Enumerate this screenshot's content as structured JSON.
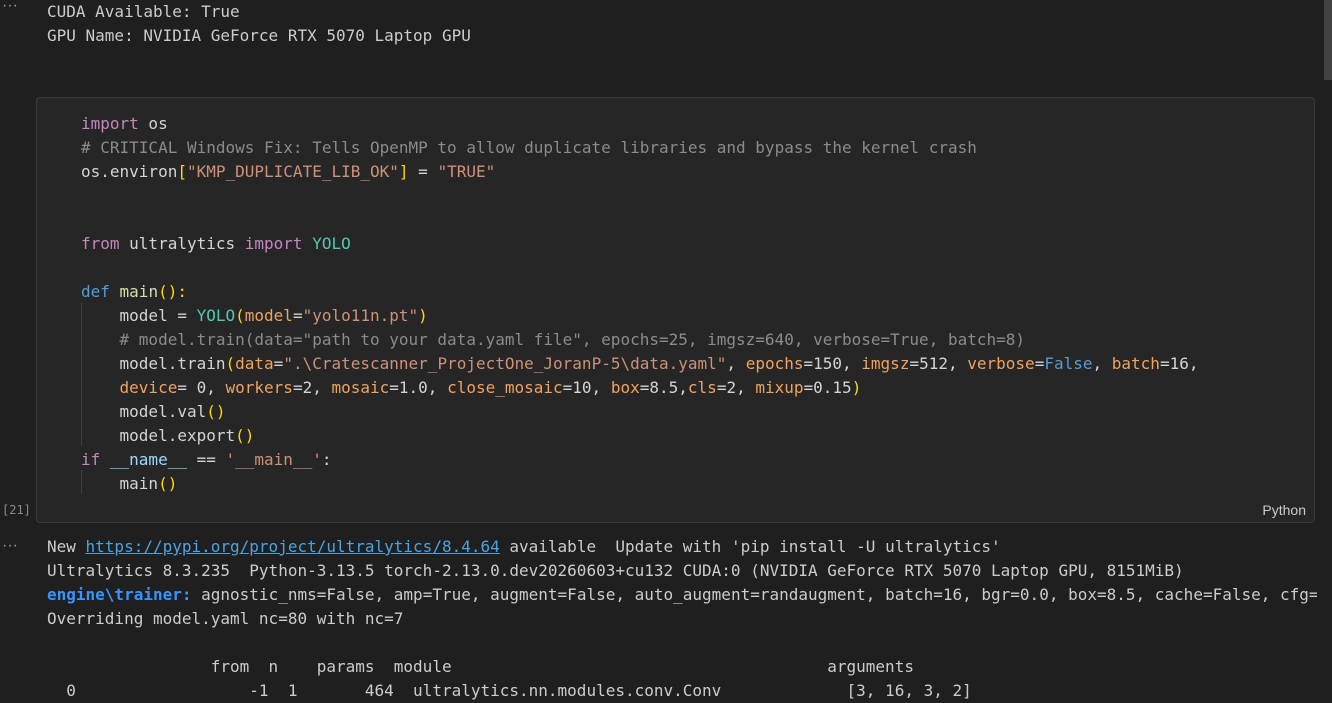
{
  "output_top": {
    "toggle_icon": "ellipsis-icon",
    "lines": [
      "CUDA Available: True",
      "GPU Name: NVIDIA GeForce RTX 5070 Laptop GPU"
    ]
  },
  "cell": {
    "execution_count": "[21]",
    "language": "Python",
    "code": {
      "l1_kw": "import",
      "l1_rest": " os",
      "l2": "# CRITICAL Windows Fix: Tells OpenMP to allow duplicate libraries and bypass the kernel crash",
      "l3_a": "os.environ",
      "l3_b": "[",
      "l3_c": "\"KMP_DUPLICATE_LIB_OK\"",
      "l3_d": "]",
      "l3_e": " = ",
      "l3_f": "\"TRUE\"",
      "l6_kw1": "from",
      "l6_mod": " ultralytics ",
      "l6_kw2": "import",
      "l6_cls": " YOLO",
      "l8_kw": "def",
      "l8_fn": " main",
      "l8_p": "():",
      "l9_a": "    model = ",
      "l9_b": "YOLO",
      "l9_c": "(",
      "l9_d": "model",
      "l9_e": "=",
      "l9_f": "\"yolo11n.pt\"",
      "l9_g": ")",
      "l10": "    # model.train(data=\"path to your data.yaml file\", epochs=25, imgsz=640, verbose=True, batch=8)",
      "l11_a": "    model.train",
      "l11_b": "(",
      "l11_c": "data",
      "l11_d": "=",
      "l11_e": "\".\\Cratescanner_ProjectOne_JoranP-5\\data.yaml\"",
      "l11_f": ", ",
      "l11_g": "epochs",
      "l11_h": "=150, ",
      "l11_i": "imgsz",
      "l11_j": "=512, ",
      "l11_k": "verbose",
      "l11_l": "=",
      "l11_m": "False",
      "l11_n": ", ",
      "l11_o": "batch",
      "l11_p": "=16,",
      "l12_a": "    ",
      "l12_b": "device",
      "l12_c": "= 0, ",
      "l12_d": "workers",
      "l12_e": "=2, ",
      "l12_f": "mosaic",
      "l12_g": "=1.0, ",
      "l12_h": "close_mosaic",
      "l12_i": "=10, ",
      "l12_j": "box",
      "l12_k": "=8.5,",
      "l12_l": "cls",
      "l12_m": "=2, ",
      "l12_n": "mixup",
      "l12_o": "=0.15",
      "l12_p": ")",
      "l13_a": "    model.val",
      "l13_b": "()",
      "l14_a": "    model.export",
      "l14_b": "()",
      "l15_kw": "if",
      "l15_a": " __name__",
      "l15_b": " == ",
      "l15_c": "'__main__'",
      "l15_d": ":",
      "l16_a": "    main",
      "l16_b": "()"
    }
  },
  "output_bottom": {
    "toggle_icon": "ellipsis-icon",
    "l1_a": "New ",
    "l1_link": "https://pypi.org/project/ultralytics/8.4.64",
    "l1_b": " available  Update with 'pip install -U ultralytics'",
    "l2": "Ultralytics 8.3.235  Python-3.13.5 torch-2.13.0.dev20260603+cu132 CUDA:0 (NVIDIA GeForce RTX 5070 Laptop GPU, 8151MiB)",
    "l3_a": "engine\\trainer:",
    "l3_b": " agnostic_nms=False, amp=True, augment=False, auto_augment=randaugment, batch=16, bgr=0.0, box=8.5, cache=False, cfg=",
    "l4": "Overriding model.yaml nc=80 with nc=7",
    "table_header": "                 from  n    params  module                                       arguments",
    "table_row": "  0                  -1  1       464  ultralytics.nn.modules.conv.Conv             [3, 16, 3, 2]"
  }
}
